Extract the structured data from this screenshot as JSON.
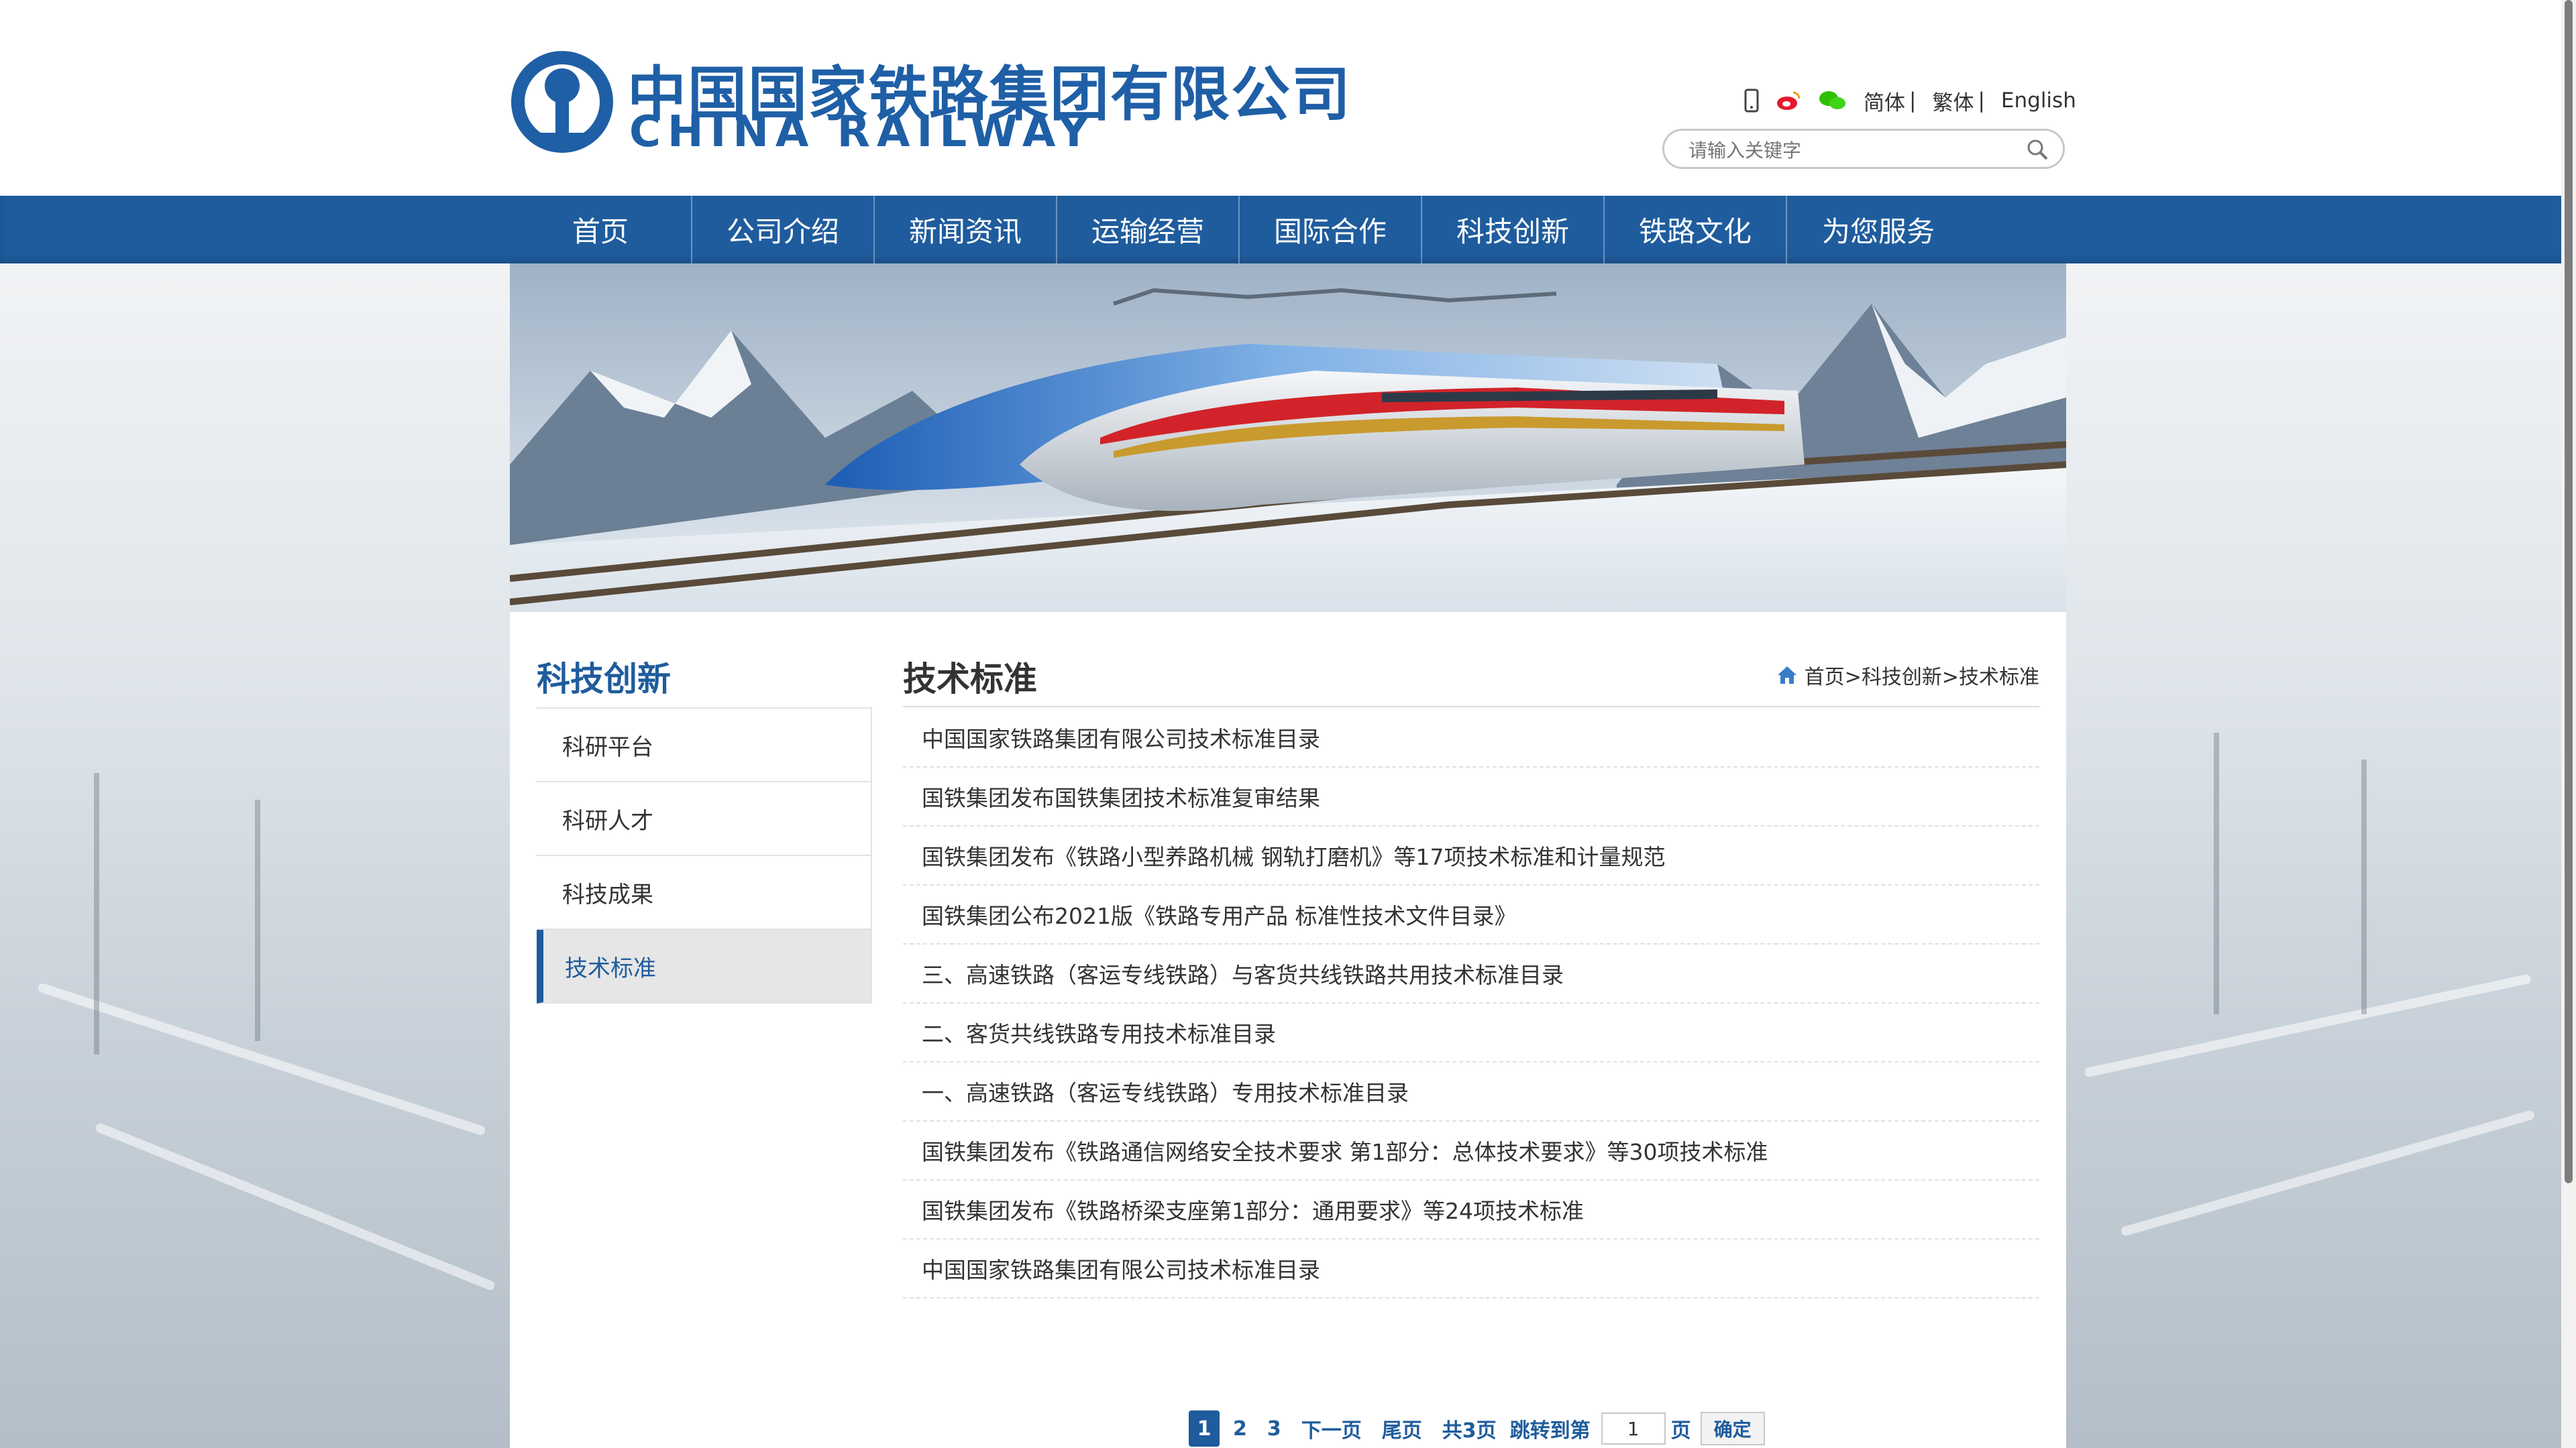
{
  "header": {
    "logo_cn": "中国国家铁路集团有限公司",
    "logo_en": "CHINA  RAILWAY",
    "lang_simplified": "简体",
    "lang_traditional": "繁体",
    "lang_english": "English",
    "sep1": "|",
    "sep2": "|",
    "icons": [
      "mobile-icon",
      "weibo-icon",
      "wechat-icon"
    ]
  },
  "search": {
    "placeholder": "请输入关键字"
  },
  "nav": {
    "items": [
      "首页",
      "公司介绍",
      "新闻资讯",
      "运输经营",
      "国际合作",
      "科技创新",
      "铁路文化",
      "为您服务"
    ]
  },
  "sidebar": {
    "title": "科技创新",
    "items": [
      "科研平台",
      "科研人才",
      "科技成果",
      "技术标准"
    ],
    "active_index": 3
  },
  "main": {
    "title": "技术标准",
    "breadcrumb": "首页>科技创新>技术标准",
    "articles": [
      "中国国家铁路集团有限公司技术标准目录",
      "国铁集团发布国铁集团技术标准复审结果",
      "国铁集团发布《铁路小型养路机械 钢轨打磨机》等17项技术标准和计量规范",
      "国铁集团公布2021版《铁路专用产品 标准性技术文件目录》",
      "三、高速铁路（客运专线铁路）与客货共线铁路共用技术标准目录",
      "二、客货共线铁路专用技术标准目录",
      "一、高速铁路（客运专线铁路）专用技术标准目录",
      "国铁集团发布《铁路通信网络安全技术要求 第1部分：总体技术要求》等30项技术标准",
      "国铁集团发布《铁路桥梁支座第1部分：通用要求》等24项技术标准",
      "中国国家铁路集团有限公司技术标准目录"
    ]
  },
  "pager": {
    "current": "1",
    "page2": "2",
    "page3": "3",
    "next": "下一页",
    "last": "尾页",
    "total": "共3页",
    "jump_label": "跳转到第",
    "jump_value": "1",
    "page_unit": "页",
    "confirm": "确定"
  },
  "colors": {
    "brand": "#1f5c9d",
    "logo": "#1f5fa6"
  }
}
